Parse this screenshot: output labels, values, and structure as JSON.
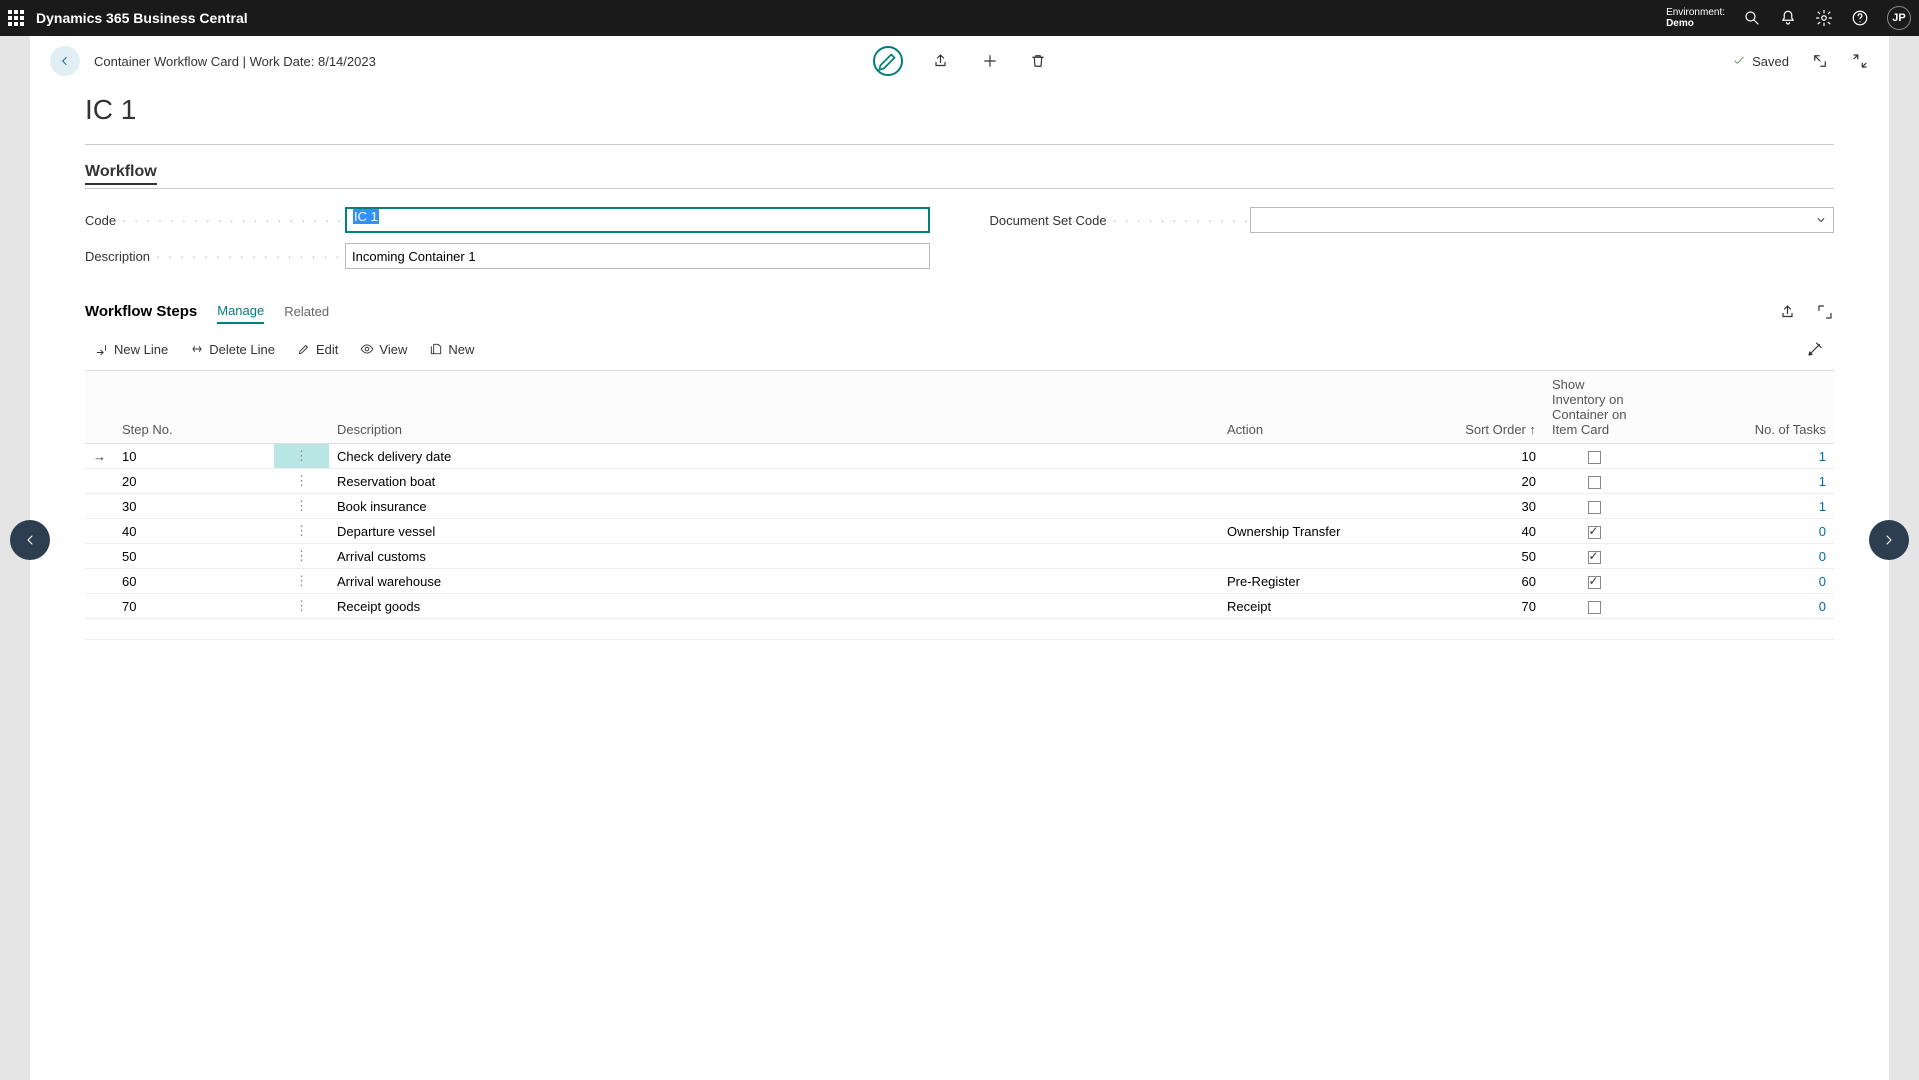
{
  "topbar": {
    "title": "Dynamics 365 Business Central",
    "env_label": "Environment:",
    "env_value": "Demo",
    "avatar_initials": "JP"
  },
  "toolbar": {
    "breadcrumb": "Container Workflow Card | Work Date: 8/14/2023",
    "saved_label": "Saved"
  },
  "page": {
    "title": "IC 1",
    "workflow_section": "Workflow",
    "fields": {
      "code_label": "Code",
      "code_value": "IC 1",
      "description_label": "Description",
      "description_value": "Incoming Container 1",
      "docset_label": "Document Set Code",
      "docset_value": ""
    },
    "steps": {
      "title": "Workflow Steps",
      "tab_manage": "Manage",
      "tab_related": "Related",
      "action_new_line": "New Line",
      "action_delete_line": "Delete Line",
      "action_edit": "Edit",
      "action_view": "View",
      "action_new": "New",
      "columns": {
        "step_no": "Step No.",
        "description": "Description",
        "action": "Action",
        "sort_order": "Sort Order ↑",
        "show_inv": "Show Inventory on Container on Item Card",
        "no_tasks": "No. of Tasks"
      },
      "rows": [
        {
          "step_no": "10",
          "description": "Check delivery date",
          "action": "",
          "sort_order": "10",
          "show_inv": false,
          "no_tasks": "1"
        },
        {
          "step_no": "20",
          "description": "Reservation boat",
          "action": "",
          "sort_order": "20",
          "show_inv": false,
          "no_tasks": "1"
        },
        {
          "step_no": "30",
          "description": "Book insurance",
          "action": "",
          "sort_order": "30",
          "show_inv": false,
          "no_tasks": "1"
        },
        {
          "step_no": "40",
          "description": "Departure vessel",
          "action": "Ownership Transfer",
          "sort_order": "40",
          "show_inv": true,
          "no_tasks": "0"
        },
        {
          "step_no": "50",
          "description": "Arrival customs",
          "action": "",
          "sort_order": "50",
          "show_inv": true,
          "no_tasks": "0"
        },
        {
          "step_no": "60",
          "description": "Arrival warehouse",
          "action": "Pre-Register",
          "sort_order": "60",
          "show_inv": true,
          "no_tasks": "0"
        },
        {
          "step_no": "70",
          "description": "Receipt goods",
          "action": "Receipt",
          "sort_order": "70",
          "show_inv": false,
          "no_tasks": "0"
        }
      ]
    }
  }
}
